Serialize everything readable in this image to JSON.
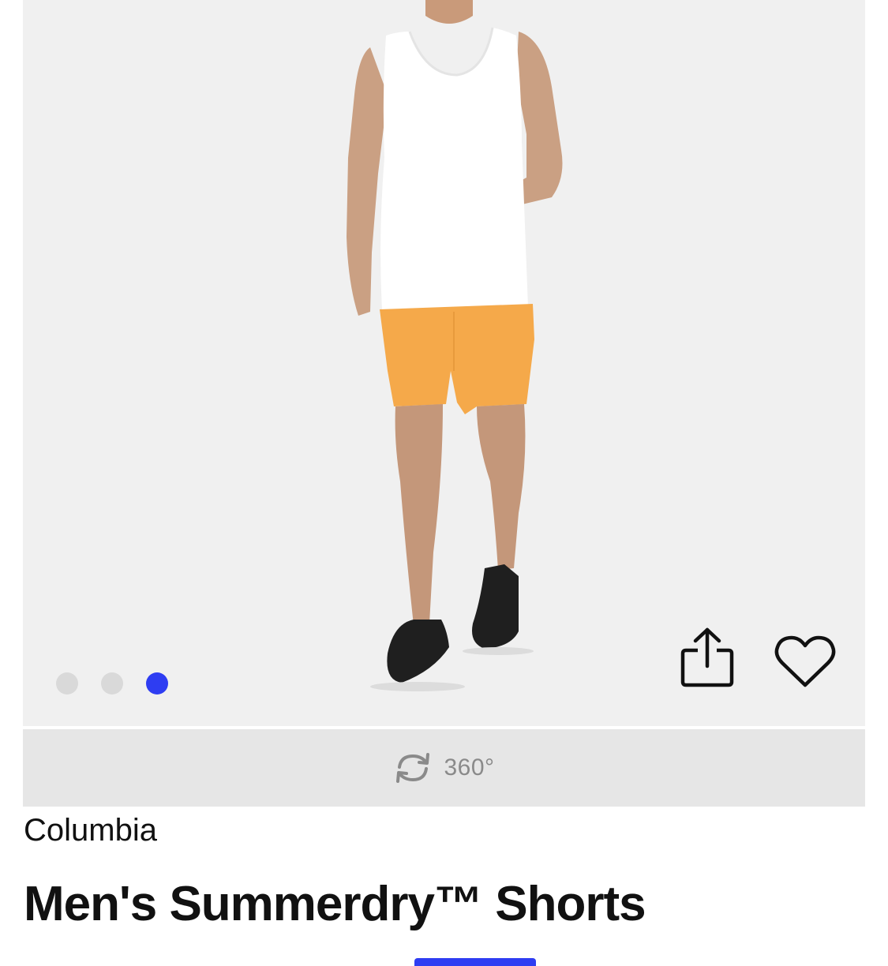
{
  "gallery": {
    "image_alt": "Model wearing white tank top, orange shorts and black sandals",
    "dots": [
      {
        "active": false
      },
      {
        "active": false
      },
      {
        "active": true
      }
    ],
    "share_icon": "share-icon",
    "favorite_icon": "heart-icon"
  },
  "view360": {
    "icon": "rotate-icon",
    "label": "360°"
  },
  "product": {
    "brand": "Columbia",
    "title": "Men's Summerdry™ Shorts"
  },
  "colors": {
    "accent": "#2e3df2",
    "gallery_bg": "#f0f0f0",
    "bar_bg": "#e6e6e6"
  }
}
